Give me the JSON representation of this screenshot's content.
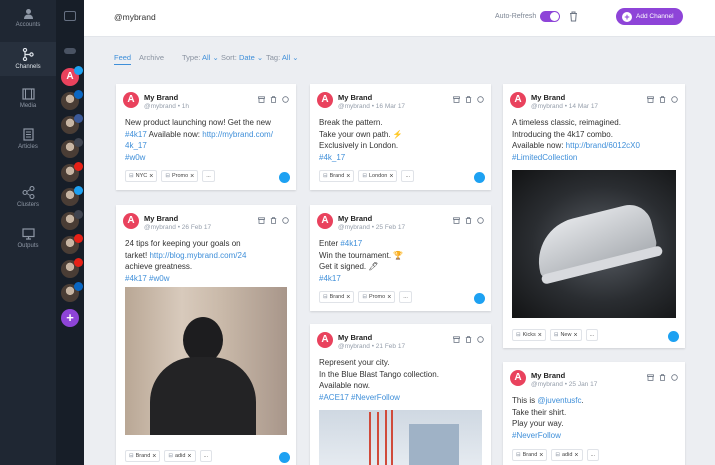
{
  "nav": {
    "items": [
      {
        "label": "Accounts",
        "icon": "user-icon"
      },
      {
        "label": "Channels",
        "icon": "branch-icon"
      },
      {
        "label": "Media",
        "icon": "film-icon"
      },
      {
        "label": "Articles",
        "icon": "document-icon"
      },
      {
        "label": "Clusters",
        "icon": "share-icon"
      },
      {
        "label": "Outputs",
        "icon": "monitor-icon"
      }
    ]
  },
  "header": {
    "title": "@mybrand",
    "auto_refresh_label": "Auto-Refresh",
    "add_channel_label": "Add Channel",
    "add_channel_icon": "plus-icon"
  },
  "filters": {
    "feed": "Feed",
    "archive": "Archive",
    "type": "Type:",
    "type_value": "All",
    "sort": "Sort:",
    "sort_value": "Date",
    "tag": "Tag:",
    "tag_value": "All"
  },
  "channels": [
    {
      "color": "#e9425d",
      "letter": "A",
      "badge": "twitter"
    },
    {
      "color": "#3a4454",
      "letter": "",
      "badge": "linkedin"
    },
    {
      "color": "#3a4454",
      "letter": "",
      "badge": "facebook"
    },
    {
      "color": "#3a4454",
      "letter": "",
      "badge": "instagram"
    },
    {
      "color": "#3a4454",
      "letter": "",
      "badge": "youtube"
    },
    {
      "color": "#3a4454",
      "letter": "",
      "badge": "twitter"
    },
    {
      "color": "#3a4454",
      "letter": "",
      "badge": "instagram"
    },
    {
      "color": "#3a4454",
      "letter": "",
      "badge": "youtube"
    },
    {
      "color": "#e9425d",
      "letter": "",
      "badge": "youtube"
    },
    {
      "color": "#3a4454",
      "letter": "",
      "badge": "linkedin"
    }
  ],
  "cards": [
    {
      "name": "My Brand",
      "handle": "@mybrand",
      "time": "1h",
      "lines": [
        [
          {
            "t": "New product launching now! Get the new"
          }
        ],
        [
          {
            "t": "#4k17",
            "l": true
          },
          {
            "t": " Available now: "
          },
          {
            "t": "http://mybrand.com/",
            "l": true
          }
        ],
        [
          {
            "t": "4k_17",
            "l": true
          }
        ],
        [
          {
            "t": "#w0w",
            "l": true
          }
        ]
      ],
      "tags": [
        "NYC",
        "Promo",
        "..."
      ]
    },
    {
      "name": "My Brand",
      "handle": "@mybrand",
      "time": "26 Feb 17",
      "lines": [
        [
          {
            "t": "24 tips for keeping your goals on"
          }
        ],
        [
          {
            "t": "tarket! "
          },
          {
            "t": "http://blog.mybrand.com/24",
            "l": true
          }
        ],
        [
          {
            "t": "achieve greatness."
          }
        ],
        [
          {
            "t": "#4k17 #w0w",
            "l": true
          }
        ]
      ],
      "tags": [
        "Brand",
        "adid",
        "..."
      ]
    },
    {
      "name": "My Brand",
      "handle": "@mybrand",
      "time": "16 Mar 17",
      "lines": [
        [
          {
            "t": "Break the pattern."
          }
        ],
        [
          {
            "t": "Take your own path. ⚡"
          }
        ],
        [
          {
            "t": "Exclusively in London."
          }
        ],
        [
          {
            "t": "#4k_17",
            "l": true
          }
        ]
      ],
      "tags": [
        "Brand",
        "London",
        "..."
      ]
    },
    {
      "name": "My Brand",
      "handle": "@mybrand",
      "time": "25 Feb 17",
      "lines": [
        [
          {
            "t": "Enter "
          },
          {
            "t": "#4k17",
            "l": true
          }
        ],
        [
          {
            "t": "Win the tournament. 🏆"
          }
        ],
        [
          {
            "t": "Get it signed. 🖊"
          }
        ],
        [
          {
            "t": "#4k17",
            "l": true
          }
        ]
      ],
      "tags": [
        "Brand",
        "Promo",
        "..."
      ]
    },
    {
      "name": "My Brand",
      "handle": "@mybrand",
      "time": "21 Feb 17",
      "lines": [
        [
          {
            "t": "Represent your city."
          }
        ],
        [
          {
            "t": "In the Blue Blast Tango collection."
          }
        ],
        [
          {
            "t": "Available now."
          }
        ],
        [
          {
            "t": "#ACE17 #NeverFollow",
            "l": true
          }
        ]
      ],
      "tags": []
    },
    {
      "name": "My Brand",
      "handle": "@mybrand",
      "time": "14 Mar 17",
      "lines": [
        [
          {
            "t": "A timeless classic, reimagined."
          }
        ],
        [
          {
            "t": "Introducing the 4k17 combo."
          }
        ],
        [
          {
            "t": "Available now: "
          },
          {
            "t": "http://brand/6012cX0",
            "l": true
          }
        ],
        [
          {
            "t": "#LimitedCollection",
            "l": true
          }
        ]
      ],
      "tags": [
        "Kicks",
        "New",
        "..."
      ]
    },
    {
      "name": "My Brand",
      "handle": "@mybrand",
      "time": "25 Jan 17",
      "lines": [
        [
          {
            "t": "This is "
          },
          {
            "t": "@juventusfc",
            "l": true
          },
          {
            "t": "."
          }
        ],
        [
          {
            "t": "Take their shirt."
          }
        ],
        [
          {
            "t": "Play your way."
          }
        ],
        [
          {
            "t": "#NeverFollow",
            "l": true
          }
        ]
      ],
      "tags": [
        "Brand",
        "adid",
        "..."
      ]
    }
  ]
}
